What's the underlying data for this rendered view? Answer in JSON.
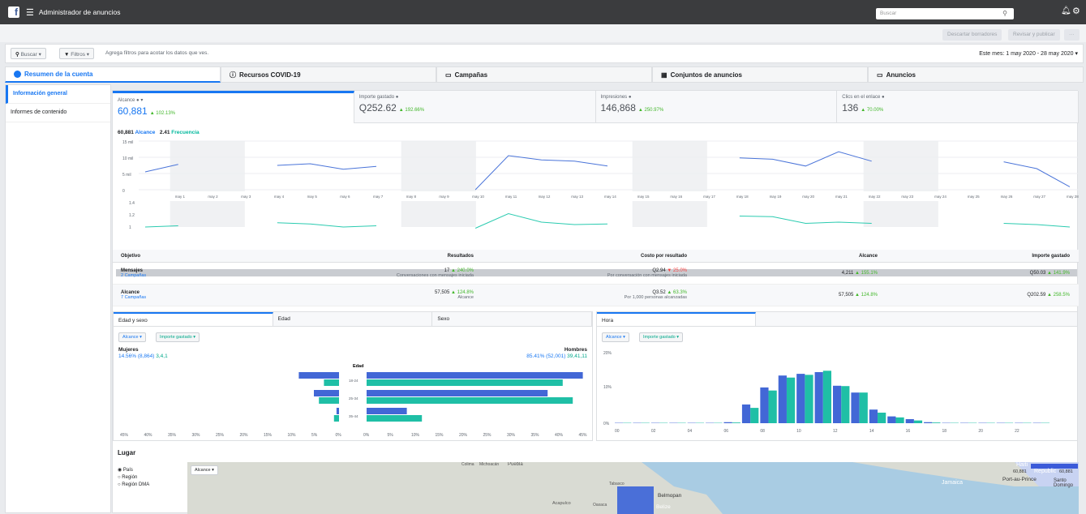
{
  "topbar": {
    "title": "Administrador de anuncios",
    "search_placeholder": "Buscar"
  },
  "toolbar": {
    "discard": "Descartar borradores",
    "review": "Revisar y publicar",
    "more": "···"
  },
  "filterbar": {
    "search": "Buscar",
    "filters": "Filtros",
    "hint": "Agrega filtros para acotar los datos que ves.",
    "date_range": "Este mes: 1 may 2020 - 28 may 2020"
  },
  "tabs": [
    "Resumen de la cuenta",
    "Recursos COVID-19",
    "Campañas",
    "Conjuntos de anuncios",
    "Anuncios"
  ],
  "sidebar": [
    "Información general",
    "Informes de contenido"
  ],
  "metrics": [
    {
      "label": "Alcance",
      "value": "60,881",
      "delta": "▲ 102.13%"
    },
    {
      "label": "Importe gastado",
      "value": "Q252.62",
      "delta": "▲ 192.66%"
    },
    {
      "label": "Impresiones",
      "value": "146,868",
      "delta": "▲ 250.97%"
    },
    {
      "label": "Clics en el enlace",
      "value": "136",
      "delta": "▲ 70.00%"
    }
  ],
  "chart_legend": {
    "alcance_val": "60,881",
    "alcance": "Alcance",
    "freq_val": "2.41",
    "freq": "Frecuencia"
  },
  "chart_data": [
    {
      "type": "line",
      "title": "",
      "series": [
        {
          "name": "Alcance",
          "values": [
            5500,
            7800,
            null,
            null,
            7500,
            8000,
            6300,
            7200,
            null,
            null,
            0,
            10500,
            9200,
            8800,
            7300,
            null,
            null,
            null,
            9800,
            9400,
            7300,
            11700,
            8800,
            null,
            null,
            null,
            8600,
            6500,
            900
          ]
        }
      ],
      "x": [
        "may 1",
        "may 2",
        "may 3",
        "may 4",
        "may 5",
        "may 6",
        "may 7",
        "may 8",
        "may 9",
        "may 10",
        "may 11",
        "may 12",
        "may 13",
        "may 14",
        "may 15",
        "may 16",
        "may 17",
        "may 18",
        "may 19",
        "may 20",
        "may 21",
        "may 22",
        "may 23",
        "may 24",
        "may 25",
        "may 26",
        "may 27",
        "may 28"
      ],
      "ylim": [
        0,
        15000
      ],
      "yticks": [
        "15 mil",
        "10 mil",
        "5 mil",
        "0"
      ]
    },
    {
      "type": "line",
      "title": "",
      "series": [
        {
          "name": "Frecuencia",
          "values": [
            1.0,
            1.02,
            null,
            null,
            1.07,
            1.05,
            1.0,
            1.02,
            null,
            null,
            0.98,
            1.22,
            1.08,
            1.04,
            1.05,
            null,
            null,
            null,
            1.18,
            1.17,
            1.06,
            1.08,
            1.06,
            null,
            null,
            null,
            1.06,
            1.04,
            1.0
          ]
        }
      ],
      "ylim": [
        1.0,
        1.4
      ],
      "yticks": [
        "1.4",
        "1.2",
        "1"
      ]
    }
  ],
  "table": {
    "headers": [
      "Objetivo",
      "Resultados",
      "Costo por resultado",
      "Alcance",
      "Importe gastado"
    ],
    "rows": [
      {
        "obj": "Mensajes",
        "camp": "2 Campañas",
        "res": "17",
        "res_d": "▲ 240.0%",
        "res_sub": "Conversaciones con mensajes iniciada",
        "cost": "Q2.94",
        "cost_d": "▼ 25.0%",
        "cost_sub": "Por conversación con mensajes iniciada",
        "reach": "4,211",
        "reach_d": "▲ 155.1%",
        "spent": "Q50.03",
        "spent_d": "▲ 141.9%"
      },
      {
        "obj": "Alcance",
        "camp": "7 Campañas",
        "res": "57,505",
        "res_d": "▲ 124.8%",
        "res_sub": "Alcance",
        "cost": "Q3.52",
        "cost_d": "▲ 63.3%",
        "cost_sub": "Por 1,000 personas alcanzadas",
        "reach": "57,505",
        "reach_d": "▲ 124.8%",
        "spent": "Q202.59",
        "spent_d": "▲ 258.5%"
      }
    ]
  },
  "age_sex": {
    "tabs": [
      "Edad y sexo",
      "Edad",
      "Sexo"
    ],
    "dd1": "Alcance",
    "dd2": "Importe gastado",
    "women": "Mujeres",
    "women_stats": "14.56% (8,864)",
    "women_spend": [
      3,
      4,
      1
    ],
    "men": "Hombres",
    "men_stats": "85.41% (52,001)",
    "men_spend": [
      39,
      41,
      11
    ],
    "age_label": "Edad",
    "groups": [
      "18-24",
      "25-34",
      "35-44"
    ],
    "women_reach": [
      8,
      5,
      0.5
    ],
    "men_reach": [
      43,
      36,
      8
    ],
    "xticks_left": [
      "45%",
      "40%",
      "35%",
      "30%",
      "25%",
      "20%",
      "15%",
      "10%",
      "5%",
      "0%"
    ],
    "xticks_right": [
      "0%",
      "5%",
      "10%",
      "15%",
      "20%",
      "25%",
      "30%",
      "35%",
      "40%",
      "45%"
    ]
  },
  "hour": {
    "tab": "Hora",
    "dd1": "Alcance",
    "dd2": "Importe gastado",
    "yticks": [
      "20%",
      "10%",
      "0%"
    ],
    "xticks": [
      "00",
      "02",
      "04",
      "06",
      "08",
      "10",
      "12",
      "14",
      "16",
      "18",
      "20",
      "22"
    ],
    "reach": [
      0.1,
      0.1,
      0.1,
      0.1,
      0.1,
      0.1,
      0.3,
      5.5,
      10.5,
      14,
      14.5,
      15,
      11,
      9,
      4,
      2,
      1.2,
      0.3,
      0.1,
      0.1,
      0.1,
      0.1,
      0.1,
      0.1
    ],
    "spend": [
      0.1,
      0.1,
      0.1,
      0.1,
      0.1,
      0.1,
      0.2,
      4.5,
      9.6,
      13.4,
      14.2,
      15.4,
      10.9,
      9,
      3.1,
      1.7,
      0.8,
      0.2,
      0.1,
      0.1,
      0.1,
      0.1,
      0.1,
      0.1
    ]
  },
  "lugar": {
    "title": "Lugar",
    "options": [
      "País",
      "Región",
      "Región DMA"
    ],
    "dd": "Alcance",
    "map_labels": [
      "Puebla",
      "Acapulco",
      "Oaxaca",
      "Belmopan",
      "Belize",
      "Haiti",
      "Republic",
      "Port-au-Prince",
      "Santo Domingo",
      "Jamaica",
      "Tabasco",
      "Colima",
      "Michoacán"
    ],
    "scale_min": "60,881",
    "scale_max": "60,881"
  },
  "colors": {
    "blue": "#1877f2",
    "bar_blue": "#4267d6",
    "teal": "#1fbfa6",
    "line_blue": "#4a74d9",
    "line_teal": "#2bcbb0"
  }
}
